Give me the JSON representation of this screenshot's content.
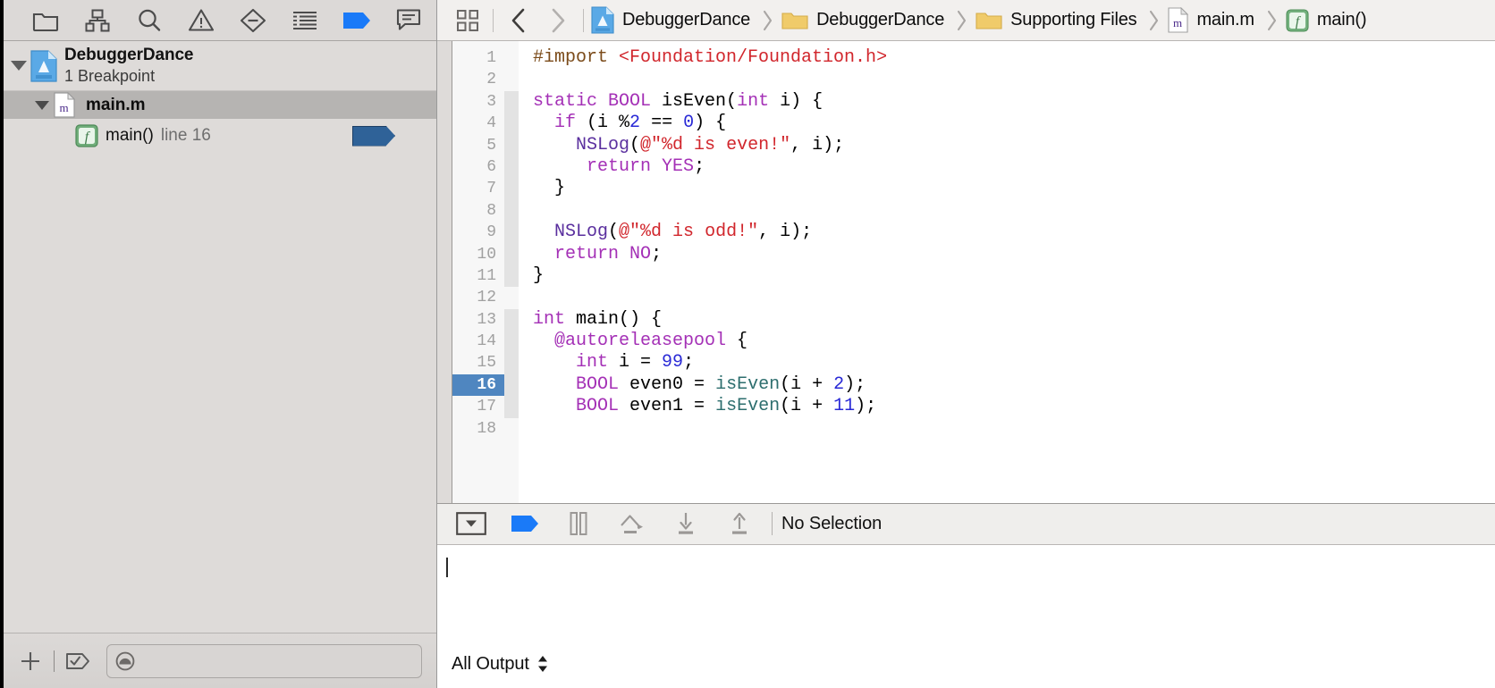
{
  "navigator": {
    "toolbar": [
      {
        "name": "project-navigator-icon",
        "label": "Project"
      },
      {
        "name": "symbol-navigator-icon",
        "label": "Symbol"
      },
      {
        "name": "find-navigator-icon",
        "label": "Find"
      },
      {
        "name": "issue-navigator-icon",
        "label": "Issue"
      },
      {
        "name": "test-navigator-icon",
        "label": "Test"
      },
      {
        "name": "debug-navigator-icon",
        "label": "Debug"
      },
      {
        "name": "breakpoint-navigator-icon",
        "label": "Breakpoint"
      },
      {
        "name": "report-navigator-icon",
        "label": "Report"
      }
    ],
    "tree": {
      "project": {
        "title": "DebuggerDance",
        "subtitle": "1 Breakpoint",
        "icon": "app-project-icon"
      },
      "file": {
        "name": "main.m",
        "icon": "objc-file-icon"
      },
      "breakpoint": {
        "symbol": "main()",
        "location": "line 16",
        "icon": "function-icon",
        "marker": "breakpoint-enabled-arrow"
      }
    },
    "footer": {
      "add_label": "+",
      "add_name": "add-breakpoint-button",
      "toggle_name": "activate-breakpoints-button",
      "filter_placeholder": "",
      "filter_value": ""
    }
  },
  "breadcrumb": {
    "related_items_name": "related-items-icon",
    "back_name": "back-button",
    "forward_name": "forward-button",
    "items": [
      {
        "label": "DebuggerDance",
        "icon": "app-project-icon"
      },
      {
        "label": "DebuggerDance",
        "icon": "folder-icon"
      },
      {
        "label": "Supporting Files",
        "icon": "folder-icon"
      },
      {
        "label": "main.m",
        "icon": "objc-file-icon"
      },
      {
        "label": "main()",
        "icon": "function-icon"
      }
    ]
  },
  "editor": {
    "current_line": 16,
    "first_line": 1,
    "last_visible_line": 18,
    "lines": [
      {
        "n": 1,
        "tokens": [
          {
            "t": "#import ",
            "c": "pre"
          },
          {
            "t": "<Foundation/Foundation.h>",
            "c": "str"
          }
        ]
      },
      {
        "n": 2,
        "tokens": []
      },
      {
        "n": 3,
        "tokens": [
          {
            "t": "static ",
            "c": "kw"
          },
          {
            "t": "BOOL ",
            "c": "kw"
          },
          {
            "t": "isEven",
            "c": "plain"
          },
          {
            "t": "(",
            "c": "plain"
          },
          {
            "t": "int",
            "c": "kw"
          },
          {
            "t": " i) {",
            "c": "plain"
          }
        ]
      },
      {
        "n": 4,
        "tokens": [
          {
            "t": "  ",
            "c": "plain"
          },
          {
            "t": "if",
            "c": "kw"
          },
          {
            "t": " (i %",
            "c": "plain"
          },
          {
            "t": "2",
            "c": "num"
          },
          {
            "t": " == ",
            "c": "plain"
          },
          {
            "t": "0",
            "c": "num"
          },
          {
            "t": ") {",
            "c": "plain"
          }
        ]
      },
      {
        "n": 5,
        "tokens": [
          {
            "t": "    ",
            "c": "plain"
          },
          {
            "t": "NSLog",
            "c": "typ"
          },
          {
            "t": "(",
            "c": "plain"
          },
          {
            "t": "@\"%d is even!\"",
            "c": "str"
          },
          {
            "t": ", i);",
            "c": "plain"
          }
        ]
      },
      {
        "n": 6,
        "tokens": [
          {
            "t": "     ",
            "c": "plain"
          },
          {
            "t": "return",
            "c": "kw"
          },
          {
            "t": " ",
            "c": "plain"
          },
          {
            "t": "YES",
            "c": "kw"
          },
          {
            "t": ";",
            "c": "plain"
          }
        ]
      },
      {
        "n": 7,
        "tokens": [
          {
            "t": "  }",
            "c": "plain"
          }
        ]
      },
      {
        "n": 8,
        "tokens": []
      },
      {
        "n": 9,
        "tokens": [
          {
            "t": "  ",
            "c": "plain"
          },
          {
            "t": "NSLog",
            "c": "typ"
          },
          {
            "t": "(",
            "c": "plain"
          },
          {
            "t": "@\"%d is odd!\"",
            "c": "str"
          },
          {
            "t": ", i);",
            "c": "plain"
          }
        ]
      },
      {
        "n": 10,
        "tokens": [
          {
            "t": "  ",
            "c": "plain"
          },
          {
            "t": "return",
            "c": "kw"
          },
          {
            "t": " ",
            "c": "plain"
          },
          {
            "t": "NO",
            "c": "kw"
          },
          {
            "t": ";",
            "c": "plain"
          }
        ]
      },
      {
        "n": 11,
        "tokens": [
          {
            "t": "}",
            "c": "plain"
          }
        ]
      },
      {
        "n": 12,
        "tokens": []
      },
      {
        "n": 13,
        "tokens": [
          {
            "t": "int",
            "c": "kw"
          },
          {
            "t": " main() {",
            "c": "plain"
          }
        ]
      },
      {
        "n": 14,
        "tokens": [
          {
            "t": "  ",
            "c": "plain"
          },
          {
            "t": "@autoreleasepool",
            "c": "kw"
          },
          {
            "t": " {",
            "c": "plain"
          }
        ]
      },
      {
        "n": 15,
        "tokens": [
          {
            "t": "    ",
            "c": "plain"
          },
          {
            "t": "int",
            "c": "kw"
          },
          {
            "t": " i = ",
            "c": "plain"
          },
          {
            "t": "99",
            "c": "num"
          },
          {
            "t": ";",
            "c": "plain"
          }
        ]
      },
      {
        "n": 16,
        "tokens": [
          {
            "t": "    ",
            "c": "plain"
          },
          {
            "t": "BOOL",
            "c": "kw"
          },
          {
            "t": " even0 = ",
            "c": "plain"
          },
          {
            "t": "isEven",
            "c": "fn"
          },
          {
            "t": "(i + ",
            "c": "plain"
          },
          {
            "t": "2",
            "c": "num"
          },
          {
            "t": ");",
            "c": "plain"
          }
        ]
      },
      {
        "n": 17,
        "tokens": [
          {
            "t": "    ",
            "c": "plain"
          },
          {
            "t": "BOOL",
            "c": "kw"
          },
          {
            "t": " even1 = ",
            "c": "plain"
          },
          {
            "t": "isEven",
            "c": "fn"
          },
          {
            "t": "(i + ",
            "c": "plain"
          },
          {
            "t": "11",
            "c": "num"
          },
          {
            "t": ");",
            "c": "plain"
          }
        ]
      }
    ]
  },
  "debug_bar": {
    "buttons": [
      {
        "name": "hide-debug-area-button",
        "label": "Hide Debug Area"
      },
      {
        "name": "deactivate-breakpoints-button",
        "label": "Deactivate Breakpoints"
      },
      {
        "name": "pause-button",
        "label": "Pause"
      },
      {
        "name": "step-over-button",
        "label": "Step Over"
      },
      {
        "name": "step-into-button",
        "label": "Step Into"
      },
      {
        "name": "step-out-button",
        "label": "Step Out"
      }
    ],
    "selection_label": "No Selection"
  },
  "console": {
    "value": "",
    "filter_label": "All Output"
  },
  "colors": {
    "accent_blue": "#1a7af8",
    "breakpoint_blue": "#2f6298",
    "current_line_blue": "#4f86c0",
    "keyword_purple": "#a430b6",
    "string_red": "#d1262c",
    "number_blue": "#2929d6",
    "preproc_brown": "#7b4b1a",
    "chrome_gray": "#dedbd9"
  }
}
